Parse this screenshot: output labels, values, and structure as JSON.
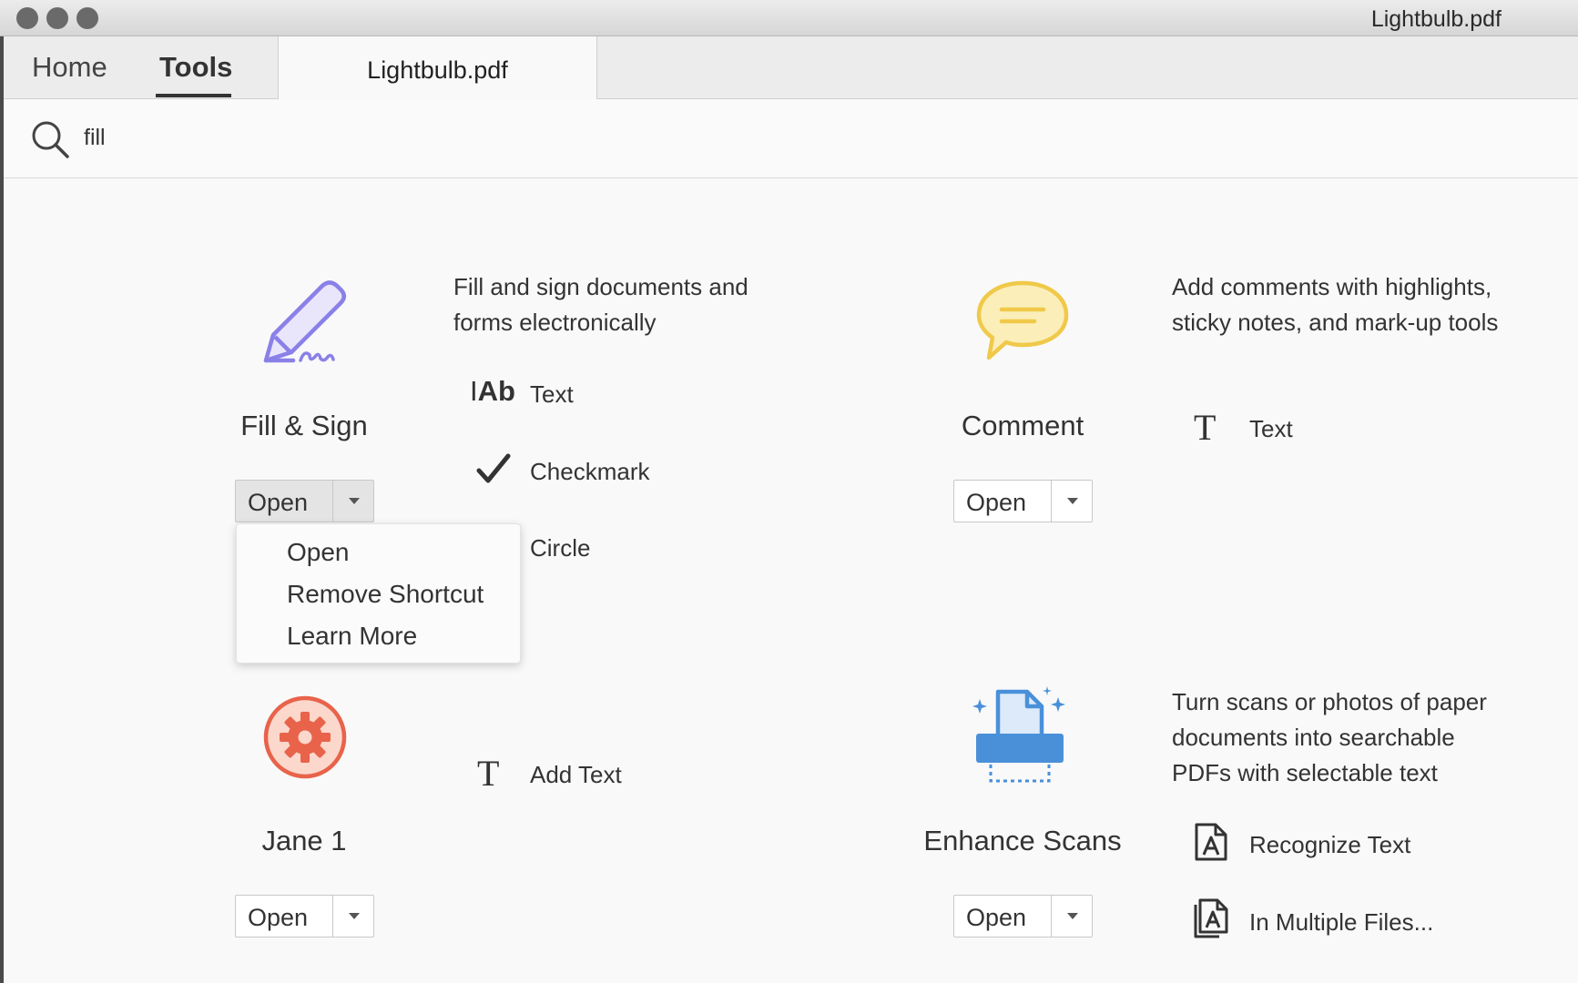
{
  "window": {
    "title": "Lightbulb.pdf"
  },
  "tabs": {
    "home": "Home",
    "tools": "Tools",
    "document": "Lightbulb.pdf"
  },
  "search": {
    "value": "fill",
    "placeholder": ""
  },
  "tools": [
    {
      "name": "Fill & Sign",
      "icon": "pen-sign-icon",
      "description": [
        "Fill and sign documents and",
        "forms electronically"
      ],
      "open_label": "Open",
      "subtools": [
        "Text",
        "Checkmark",
        "Circle"
      ]
    },
    {
      "name": "Comment",
      "icon": "speech-bubble-icon",
      "description": [
        "Add comments with highlights,",
        "sticky notes, and mark-up tools"
      ],
      "open_label": "Open",
      "subtools": [
        "Text"
      ]
    },
    {
      "name": "Jane 1",
      "icon": "gear-icon",
      "description": [],
      "open_label": "Open",
      "subtools": [
        "Add Text"
      ]
    },
    {
      "name": "Enhance Scans",
      "icon": "scanner-icon",
      "description": [
        "Turn scans or photos of paper",
        "documents into searchable",
        "PDFs with selectable text"
      ],
      "open_label": "Open",
      "subtools": [
        "Recognize Text",
        "In Multiple Files..."
      ]
    }
  ],
  "dropdown_menu": {
    "items": [
      "Open",
      "Remove Shortcut",
      "Learn More"
    ]
  },
  "colors": {
    "fill_sign": "#8a80e8",
    "comment": "#f0c94a",
    "custom_tool": "#e8634a",
    "enhance_scans": "#4a90d9"
  }
}
